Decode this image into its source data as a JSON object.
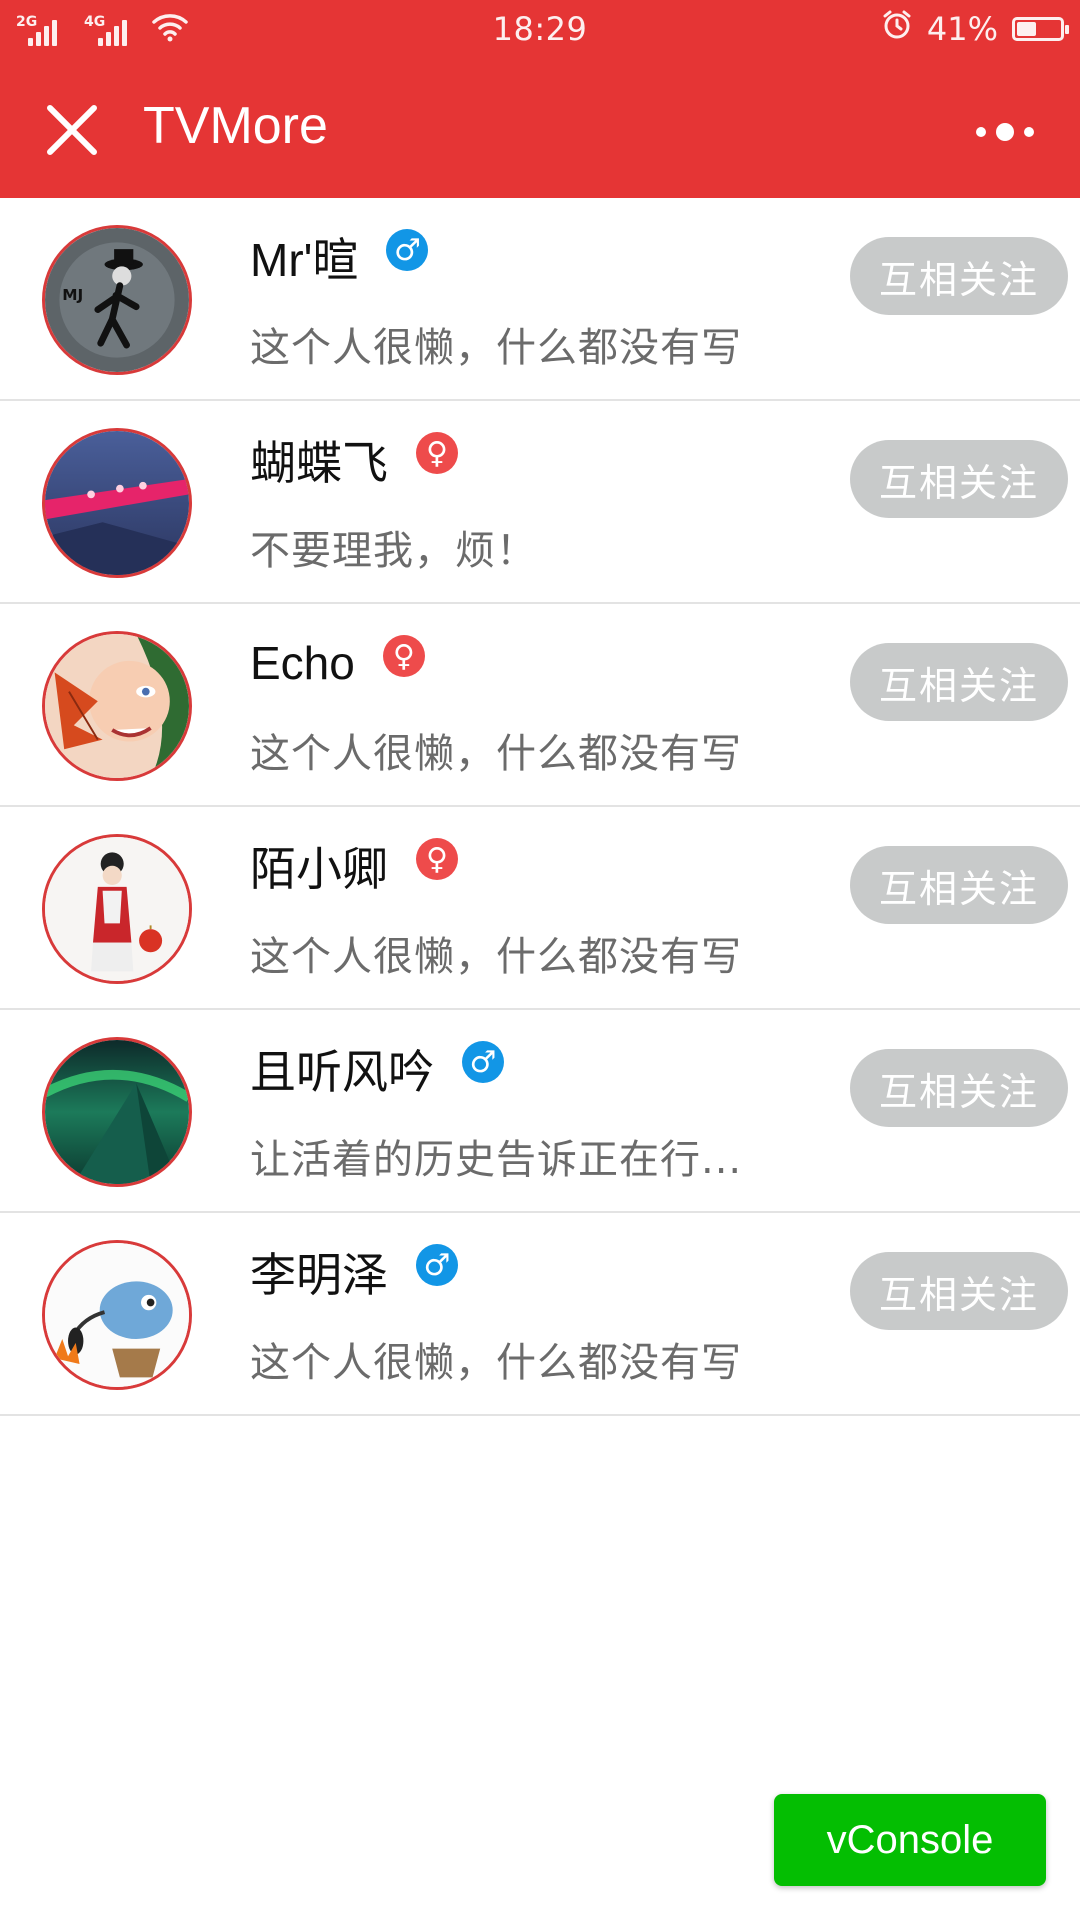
{
  "status_bar": {
    "network1": "2G",
    "network2": "4G",
    "time": "18:29",
    "battery_percent": "41%",
    "battery_level": 0.41,
    "icons": [
      "signal-icon",
      "wifi-icon",
      "alarm-icon",
      "battery-icon"
    ]
  },
  "nav": {
    "title": "TVMore",
    "close_icon": "close-icon",
    "more_icon": "more-dots-icon"
  },
  "colors": {
    "brand": "#e53535",
    "male": "#1296e6",
    "female": "#ee4b4b",
    "follow_button": "#c8caca",
    "vconsole": "#04be02"
  },
  "users": [
    {
      "name": "Mr'暄",
      "gender": "male",
      "gender_symbol": "♂",
      "bio": "这个人很懒，什么都没有写",
      "button": "互相关注"
    },
    {
      "name": "蝴蝶飞",
      "gender": "female",
      "gender_symbol": "♀",
      "bio": "不要理我，烦！",
      "button": "互相关注"
    },
    {
      "name": "Echo",
      "gender": "female",
      "gender_symbol": "♀",
      "bio": "这个人很懒，什么都没有写",
      "button": "互相关注"
    },
    {
      "name": "陌小卿",
      "gender": "female",
      "gender_symbol": "♀",
      "bio": "这个人很懒，什么都没有写",
      "button": "互相关注"
    },
    {
      "name": "且听风吟",
      "gender": "male",
      "gender_symbol": "♂",
      "bio": "让活着的历史告诉正在行...",
      "button": "互相关注"
    },
    {
      "name": "李明泽",
      "gender": "male",
      "gender_symbol": "♂",
      "bio": "这个人很懒，什么都没有写",
      "button": "互相关注"
    }
  ],
  "vconsole_label": "vConsole"
}
